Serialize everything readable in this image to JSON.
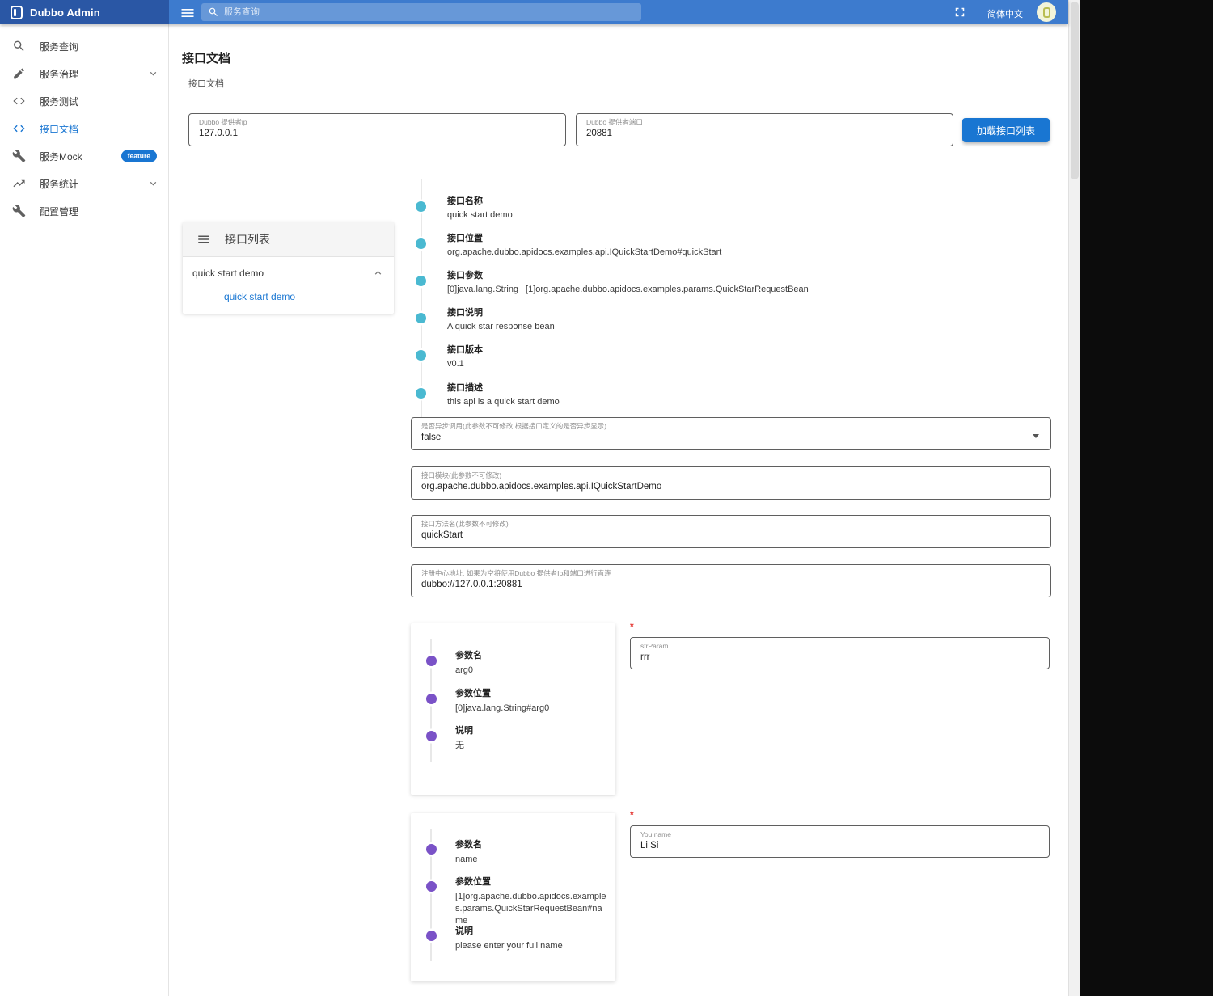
{
  "colors": {
    "accent": "#1976d2",
    "header_bar": "#3d7bce",
    "header_brand": "#2a57a5",
    "api_timeline_dot": "#4ab9d1",
    "param_timeline_dot": "#7a52c7",
    "required_marker": "#e53935"
  },
  "header": {
    "brand": "Dubbo Admin",
    "search_placeholder": "服务查询",
    "language": "简体中文"
  },
  "sidebar": {
    "items": [
      {
        "label": "服务查询"
      },
      {
        "label": "服务治理"
      },
      {
        "label": "服务测试"
      },
      {
        "label": "接口文档"
      },
      {
        "label": "服务Mock",
        "badge": "feature"
      },
      {
        "label": "服务统计"
      },
      {
        "label": "配置管理"
      }
    ]
  },
  "page": {
    "title": "接口文档",
    "breadcrumb": "接口文档"
  },
  "provider": {
    "ip_label": "Dubbo 提供者ip",
    "ip_value": "127.0.0.1",
    "port_label": "Dubbo 提供者端口",
    "port_value": "20881",
    "load_button": "加载接口列表"
  },
  "api_list": {
    "title": "接口列表",
    "group_label": "quick start demo",
    "method_link": "quick start demo"
  },
  "api_info": {
    "items": [
      {
        "label": "接口名称",
        "value": "quick start demo"
      },
      {
        "label": "接口位置",
        "value": "org.apache.dubbo.apidocs.examples.api.IQuickStartDemo#quickStart"
      },
      {
        "label": "接口参数",
        "value": "[0]java.lang.String | [1]org.apache.dubbo.apidocs.examples.params.QuickStarRequestBean"
      },
      {
        "label": "接口说明",
        "value": "A quick star response bean"
      },
      {
        "label": "接口版本",
        "value": "v0.1"
      },
      {
        "label": "接口描述",
        "value": "this api is a quick start demo"
      }
    ]
  },
  "fields": [
    {
      "label": "是否异步调用(此参数不可修改,根据接口定义的是否异步显示)",
      "value": "false"
    },
    {
      "label": "接口模块(此参数不可修改)",
      "value": "org.apache.dubbo.apidocs.examples.api.IQuickStartDemo"
    },
    {
      "label": "接口方法名(此参数不可修改)",
      "value": "quickStart"
    },
    {
      "label": "注册中心地址, 如果为空将使用Dubbo 提供者Ip和端口进行直连",
      "value": "dubbo://127.0.0.1:20881"
    }
  ],
  "params": [
    {
      "info": [
        {
          "label": "参数名",
          "value": "arg0"
        },
        {
          "label": "参数位置",
          "value": "[0]java.lang.String#arg0"
        },
        {
          "label": "说明",
          "value": "无"
        }
      ],
      "input": {
        "required": "*",
        "label": "strParam",
        "value": "rrr"
      }
    },
    {
      "info": [
        {
          "label": "参数名",
          "value": "name"
        },
        {
          "label": "参数位置",
          "value": "[1]org.apache.dubbo.apidocs.examples.params.QuickStarRequestBean#name"
        },
        {
          "label": "说明",
          "value": "please enter your full name"
        }
      ],
      "input": {
        "required": "*",
        "label": "You name",
        "value": "Li Si"
      }
    }
  ]
}
